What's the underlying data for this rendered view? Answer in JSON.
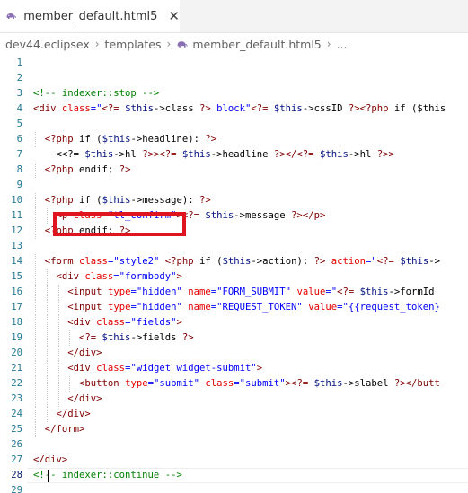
{
  "tab": {
    "title": "member_default.html5",
    "close_glyph": "✕",
    "icon": "elephant-php-icon",
    "icon_color": "#8a6fb5"
  },
  "breadcrumb": {
    "items": [
      "dev44.eclipsex",
      "templates",
      "member_default.html5",
      "..."
    ]
  },
  "editor": {
    "active_line": 28,
    "highlight_color": "#e0141e",
    "lines": [
      {
        "n": "1",
        "segs": []
      },
      {
        "n": "2",
        "segs": []
      },
      {
        "n": "3",
        "segs": [
          {
            "t": "<!-- indexer::stop -->",
            "c": "com"
          }
        ]
      },
      {
        "n": "4",
        "segs": [
          {
            "t": "<div ",
            "c": "tag"
          },
          {
            "t": "class",
            "c": "attr"
          },
          {
            "t": "=\"",
            "c": "str"
          },
          {
            "t": "<?= ",
            "c": "php"
          },
          {
            "t": "$this",
            "c": "var"
          },
          {
            "t": "->class ",
            "c": ""
          },
          {
            "t": "?>",
            "c": "php"
          },
          {
            "t": " block\"",
            "c": "str"
          },
          {
            "t": "<?= ",
            "c": "php"
          },
          {
            "t": "$this",
            "c": "var"
          },
          {
            "t": "->cssID ",
            "c": ""
          },
          {
            "t": "?><?php ",
            "c": "php"
          },
          {
            "t": "if ($this",
            "c": ""
          }
        ]
      },
      {
        "n": "5",
        "segs": []
      },
      {
        "n": "6",
        "segs": [
          {
            "t": "  ",
            "c": ""
          },
          {
            "t": "<?php ",
            "c": "php"
          },
          {
            "t": "if (",
            "c": ""
          },
          {
            "t": "$this",
            "c": "var"
          },
          {
            "t": "->headline): ",
            "c": ""
          },
          {
            "t": "?>",
            "c": "php"
          }
        ]
      },
      {
        "n": "7",
        "segs": [
          {
            "t": "    <<?= ",
            "c": ""
          },
          {
            "t": "$this",
            "c": "var"
          },
          {
            "t": "->hl ",
            "c": ""
          },
          {
            "t": "?>><?= ",
            "c": "php"
          },
          {
            "t": "$this",
            "c": "var"
          },
          {
            "t": "->headline ",
            "c": ""
          },
          {
            "t": "?></<?= ",
            "c": "php"
          },
          {
            "t": "$this",
            "c": "var"
          },
          {
            "t": "->hl ",
            "c": ""
          },
          {
            "t": "?>>",
            "c": "php"
          }
        ]
      },
      {
        "n": "8",
        "segs": [
          {
            "t": "  ",
            "c": ""
          },
          {
            "t": "<?php ",
            "c": "php"
          },
          {
            "t": "endif; ",
            "c": ""
          },
          {
            "t": "?>",
            "c": "php"
          }
        ]
      },
      {
        "n": "9",
        "segs": []
      },
      {
        "n": "10",
        "segs": [
          {
            "t": "  ",
            "c": ""
          },
          {
            "t": "<?php ",
            "c": "php"
          },
          {
            "t": "if (",
            "c": ""
          },
          {
            "t": "$this",
            "c": "var"
          },
          {
            "t": "->message): ",
            "c": ""
          },
          {
            "t": "?>",
            "c": "php"
          }
        ]
      },
      {
        "n": "11",
        "segs": [
          {
            "t": "    ",
            "c": ""
          },
          {
            "t": "<p ",
            "c": "tag"
          },
          {
            "t": "class",
            "c": "attr"
          },
          {
            "t": "=\"tl_confirm\"",
            "c": "str"
          },
          {
            "t": ">",
            "c": "tag"
          },
          {
            "t": "<?= ",
            "c": "php"
          },
          {
            "t": "$this",
            "c": "var"
          },
          {
            "t": "->message ",
            "c": ""
          },
          {
            "t": "?>",
            "c": "php"
          },
          {
            "t": "</p>",
            "c": "tag"
          }
        ]
      },
      {
        "n": "12",
        "segs": [
          {
            "t": "  ",
            "c": ""
          },
          {
            "t": "<?php ",
            "c": "php"
          },
          {
            "t": "endif; ",
            "c": ""
          },
          {
            "t": "?>",
            "c": "php"
          }
        ]
      },
      {
        "n": "13",
        "segs": []
      },
      {
        "n": "14",
        "segs": [
          {
            "t": "  ",
            "c": ""
          },
          {
            "t": "<form ",
            "c": "tag"
          },
          {
            "t": "class",
            "c": "attr"
          },
          {
            "t": "=\"style2\"",
            "c": "str"
          },
          {
            "t": " ",
            "c": ""
          },
          {
            "t": "<?php ",
            "c": "php"
          },
          {
            "t": "if (",
            "c": ""
          },
          {
            "t": "$this",
            "c": "var"
          },
          {
            "t": "->action): ",
            "c": ""
          },
          {
            "t": "?>",
            "c": "php"
          },
          {
            "t": " ",
            "c": ""
          },
          {
            "t": "action",
            "c": "attr"
          },
          {
            "t": "=\"",
            "c": "str"
          },
          {
            "t": "<?= ",
            "c": "php"
          },
          {
            "t": "$this",
            "c": "var"
          },
          {
            "t": "->",
            "c": ""
          }
        ]
      },
      {
        "n": "15",
        "segs": [
          {
            "t": "    ",
            "c": ""
          },
          {
            "t": "<div ",
            "c": "tag"
          },
          {
            "t": "class",
            "c": "attr"
          },
          {
            "t": "=\"formbody\"",
            "c": "str"
          },
          {
            "t": ">",
            "c": "tag"
          }
        ]
      },
      {
        "n": "16",
        "segs": [
          {
            "t": "      ",
            "c": ""
          },
          {
            "t": "<input ",
            "c": "tag"
          },
          {
            "t": "type",
            "c": "attr"
          },
          {
            "t": "=\"hidden\"",
            "c": "str"
          },
          {
            "t": " ",
            "c": ""
          },
          {
            "t": "name",
            "c": "attr"
          },
          {
            "t": "=\"FORM_SUBMIT\"",
            "c": "str"
          },
          {
            "t": " ",
            "c": ""
          },
          {
            "t": "value",
            "c": "attr"
          },
          {
            "t": "=\"",
            "c": "str"
          },
          {
            "t": "<?= ",
            "c": "php"
          },
          {
            "t": "$this",
            "c": "var"
          },
          {
            "t": "->formId",
            "c": ""
          }
        ]
      },
      {
        "n": "17",
        "segs": [
          {
            "t": "      ",
            "c": ""
          },
          {
            "t": "<input ",
            "c": "tag"
          },
          {
            "t": "type",
            "c": "attr"
          },
          {
            "t": "=\"hidden\"",
            "c": "str"
          },
          {
            "t": " ",
            "c": ""
          },
          {
            "t": "name",
            "c": "attr"
          },
          {
            "t": "=\"REQUEST_TOKEN\"",
            "c": "str"
          },
          {
            "t": " ",
            "c": ""
          },
          {
            "t": "value",
            "c": "attr"
          },
          {
            "t": "=\"{{request_token}",
            "c": "str"
          }
        ]
      },
      {
        "n": "18",
        "segs": [
          {
            "t": "      ",
            "c": ""
          },
          {
            "t": "<div ",
            "c": "tag"
          },
          {
            "t": "class",
            "c": "attr"
          },
          {
            "t": "=\"fields\"",
            "c": "str"
          },
          {
            "t": ">",
            "c": "tag"
          }
        ]
      },
      {
        "n": "19",
        "segs": [
          {
            "t": "        ",
            "c": ""
          },
          {
            "t": "<?= ",
            "c": "php"
          },
          {
            "t": "$this",
            "c": "var"
          },
          {
            "t": "->fields ",
            "c": ""
          },
          {
            "t": "?>",
            "c": "php"
          }
        ]
      },
      {
        "n": "20",
        "segs": [
          {
            "t": "      ",
            "c": ""
          },
          {
            "t": "</div>",
            "c": "tag"
          }
        ]
      },
      {
        "n": "21",
        "segs": [
          {
            "t": "      ",
            "c": ""
          },
          {
            "t": "<div ",
            "c": "tag"
          },
          {
            "t": "class",
            "c": "attr"
          },
          {
            "t": "=\"widget widget-submit\"",
            "c": "str"
          },
          {
            "t": ">",
            "c": "tag"
          }
        ]
      },
      {
        "n": "22",
        "segs": [
          {
            "t": "        ",
            "c": ""
          },
          {
            "t": "<button ",
            "c": "tag"
          },
          {
            "t": "type",
            "c": "attr"
          },
          {
            "t": "=\"submit\"",
            "c": "str"
          },
          {
            "t": " ",
            "c": ""
          },
          {
            "t": "class",
            "c": "attr"
          },
          {
            "t": "=\"submit\"",
            "c": "str"
          },
          {
            "t": ">",
            "c": "tag"
          },
          {
            "t": "<?= ",
            "c": "php"
          },
          {
            "t": "$this",
            "c": "var"
          },
          {
            "t": "->slabel ",
            "c": ""
          },
          {
            "t": "?>",
            "c": "php"
          },
          {
            "t": "</butt",
            "c": "tag"
          }
        ]
      },
      {
        "n": "23",
        "segs": [
          {
            "t": "      ",
            "c": ""
          },
          {
            "t": "</div>",
            "c": "tag"
          }
        ]
      },
      {
        "n": "24",
        "segs": [
          {
            "t": "    ",
            "c": ""
          },
          {
            "t": "</div>",
            "c": "tag"
          }
        ]
      },
      {
        "n": "25",
        "segs": [
          {
            "t": "  ",
            "c": ""
          },
          {
            "t": "</form>",
            "c": "tag"
          }
        ]
      },
      {
        "n": "26",
        "segs": []
      },
      {
        "n": "27",
        "segs": [
          {
            "t": "</div>",
            "c": "tag"
          }
        ]
      },
      {
        "n": "28",
        "segs": [
          {
            "t": "<!-- indexer::continue -->",
            "c": "com"
          }
        ]
      },
      {
        "n": "29",
        "segs": []
      }
    ]
  }
}
